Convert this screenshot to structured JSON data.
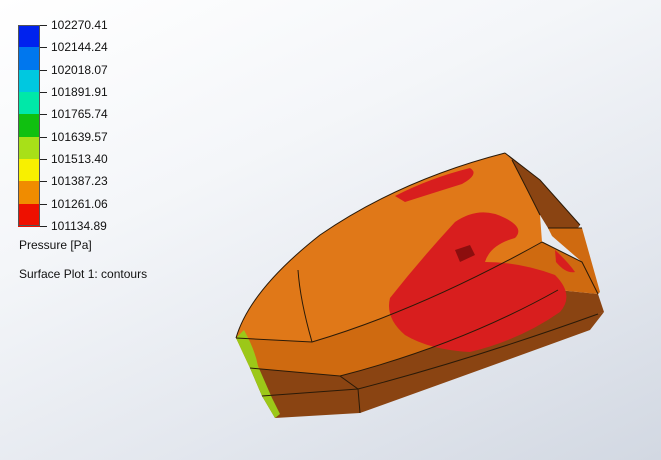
{
  "legend": {
    "title": "Pressure [Pa]",
    "plot_name": "Surface Plot 1: contours",
    "tick_labels": [
      "102270.41",
      "102144.24",
      "102018.07",
      "101891.91",
      "101765.74",
      "101639.57",
      "101513.40",
      "101387.23",
      "101261.06",
      "101134.89"
    ],
    "colors": [
      "#0022ee",
      "#0077ee",
      "#00c8e0",
      "#00e8a8",
      "#10c010",
      "#a8e018",
      "#f8f000",
      "#f08c00",
      "#ee1000"
    ]
  },
  "model": {
    "colors": {
      "orange": "#cf6a10",
      "orange_light": "#e07818",
      "orange_dark": "#8a4412",
      "red": "#d81e1e",
      "red_dark": "#8c0e0e",
      "green": "#9cc818",
      "edge": "#2a1a08"
    }
  }
}
